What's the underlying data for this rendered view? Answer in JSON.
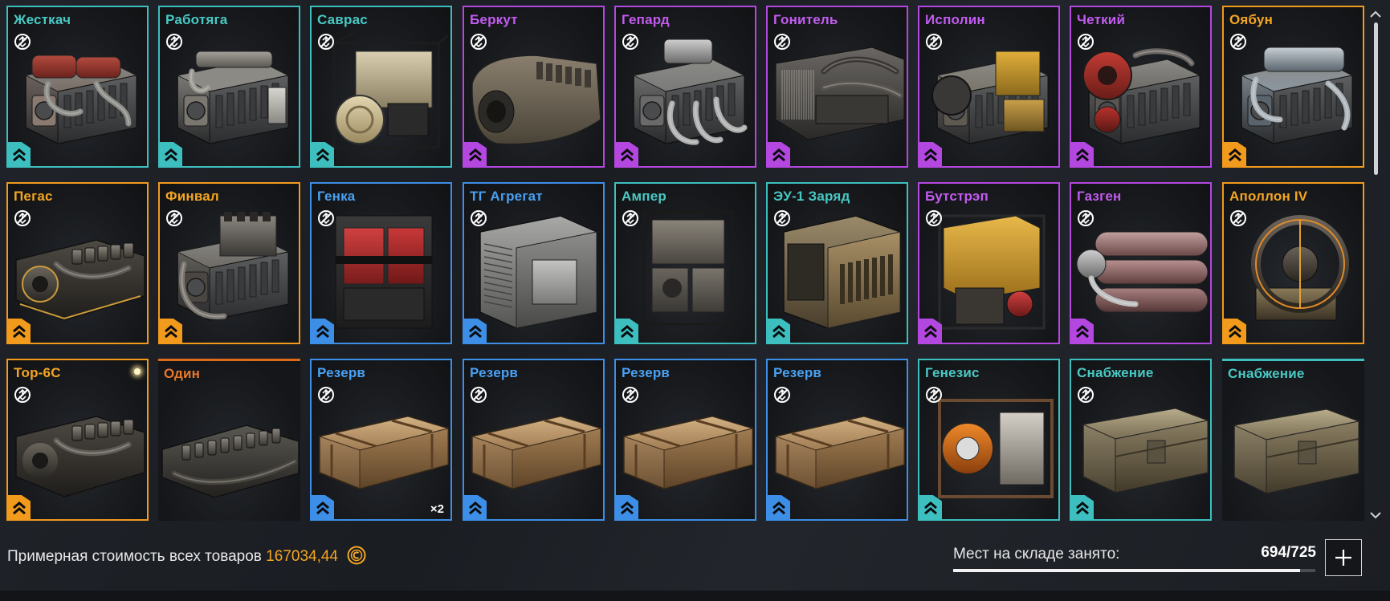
{
  "items": [
    {
      "name": "Жесткач",
      "rarity": "teal",
      "art": "engine-red",
      "notrade": true,
      "badge": true
    },
    {
      "name": "Работяга",
      "rarity": "teal",
      "art": "engine-grey",
      "notrade": true,
      "badge": true
    },
    {
      "name": "Саврас",
      "rarity": "teal",
      "art": "engine-caged",
      "notrade": true,
      "badge": true
    },
    {
      "name": "Беркут",
      "rarity": "purple",
      "art": "engine-block",
      "notrade": true,
      "badge": true
    },
    {
      "name": "Гепард",
      "rarity": "purple",
      "art": "engine-v",
      "notrade": true,
      "badge": true
    },
    {
      "name": "Гонитель",
      "rarity": "purple",
      "art": "engine-long",
      "notrade": true,
      "badge": true
    },
    {
      "name": "Исполин",
      "rarity": "purple",
      "art": "engine-yellow",
      "notrade": true,
      "badge": true
    },
    {
      "name": "Четкий",
      "rarity": "purple",
      "art": "engine-redfan",
      "notrade": true,
      "badge": true
    },
    {
      "name": "Оябун",
      "rarity": "orange",
      "art": "engine-chrome",
      "notrade": true,
      "badge": true
    },
    {
      "name": "Пегас",
      "rarity": "orange",
      "art": "engine-flat",
      "notrade": true,
      "badge": true
    },
    {
      "name": "Финвал",
      "rarity": "orange",
      "art": "engine-tall",
      "notrade": true,
      "badge": true
    },
    {
      "name": "Генка",
      "rarity": "blue",
      "art": "generator-red",
      "notrade": true,
      "badge": true
    },
    {
      "name": "ТГ Агрегат",
      "rarity": "blue",
      "art": "generator-box",
      "notrade": true,
      "badge": true
    },
    {
      "name": "Ампер",
      "rarity": "teal",
      "art": "generator-frame",
      "notrade": true,
      "badge": true
    },
    {
      "name": "ЭУ-1 Заряд",
      "rarity": "teal",
      "art": "generator-rust",
      "notrade": true,
      "badge": true
    },
    {
      "name": "Бутстрэп",
      "rarity": "purple",
      "art": "generator-yellow",
      "notrade": true,
      "badge": true
    },
    {
      "name": "Газген",
      "rarity": "purple",
      "art": "gas-tanks",
      "notrade": true,
      "badge": true
    },
    {
      "name": "Аполлон IV",
      "rarity": "orange",
      "art": "reactor-ring",
      "notrade": true,
      "badge": true
    },
    {
      "name": "Тор-6С",
      "rarity": "orange",
      "art": "engine-flat2",
      "notrade": true,
      "badge": true,
      "glow": true
    },
    {
      "name": "Один",
      "rarity": "orange",
      "art": "engine-low",
      "notrade": false,
      "badge": false,
      "open": true
    },
    {
      "name": "Резерв",
      "rarity": "blue",
      "art": "crate-wood",
      "notrade": true,
      "badge": true,
      "qty": "×2"
    },
    {
      "name": "Резерв",
      "rarity": "blue",
      "art": "crate-wood",
      "notrade": true,
      "badge": true
    },
    {
      "name": "Резерв",
      "rarity": "blue",
      "art": "crate-wood",
      "notrade": true,
      "badge": true
    },
    {
      "name": "Резерв",
      "rarity": "blue",
      "art": "crate-wood",
      "notrade": true,
      "badge": true
    },
    {
      "name": "Генезис",
      "rarity": "teal",
      "art": "generator-orange",
      "notrade": true,
      "badge": true
    },
    {
      "name": "Снабжение",
      "rarity": "teal",
      "art": "crate-metal",
      "notrade": true,
      "badge": true
    },
    {
      "name": "Снабжение",
      "rarity": "teal",
      "art": "crate-metal",
      "notrade": false,
      "badge": false,
      "open": true
    }
  ],
  "colors": {
    "teal": "#3dbfbf",
    "purple": "#b347e0",
    "orange": "#f29a1c",
    "blue": "#3d8ee6",
    "currency": "#f5a623"
  },
  "icons": {
    "notrade": "no-trade-icon",
    "upgrade": "upgrade-chevrons-icon",
    "coin": "coin-icon",
    "expand": "plus-icon",
    "scroll_up": "chevron-up-icon",
    "scroll_down": "chevron-down-icon"
  },
  "footer": {
    "total_label": "Примерная стоимость всех товаров",
    "total_value": "167034,44",
    "storage_label": "Мест на складе занято:",
    "storage_value": "694/725",
    "storage_used": 694,
    "storage_capacity": 725
  }
}
